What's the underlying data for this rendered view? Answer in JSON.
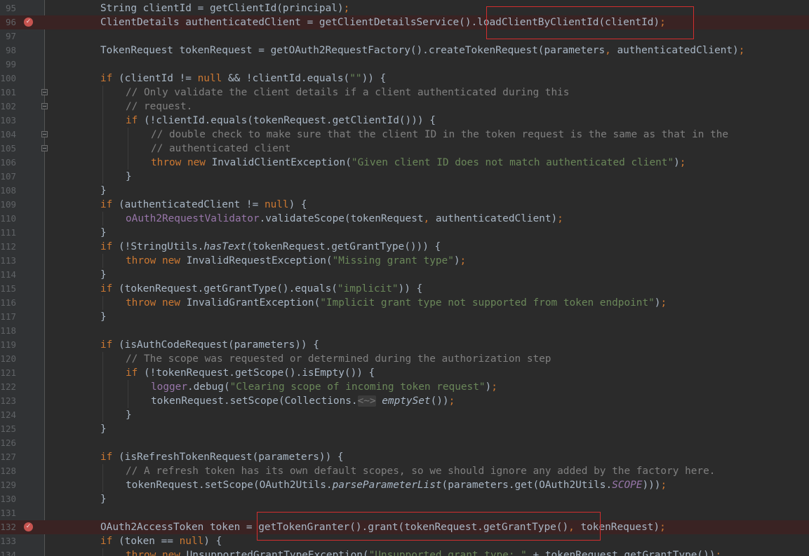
{
  "editor": {
    "lines": [
      {
        "n": "95",
        "indent": 0,
        "tokens": [
          [
            "",
            "String clientId = getClientId(principal)"
          ],
          [
            "kw",
            ";"
          ]
        ]
      },
      {
        "n": "96",
        "indent": 0,
        "breakpoint": true,
        "tokens": [
          [
            "",
            "ClientDetails authenticatedClient = getClientDetailsService().loadClientByClientId(clientId)"
          ],
          [
            "kw",
            ";"
          ]
        ]
      },
      {
        "n": "97",
        "indent": 0,
        "tokens": []
      },
      {
        "n": "98",
        "indent": 0,
        "tokens": [
          [
            "",
            "TokenRequest tokenRequest = getOAuth2RequestFactory().createTokenRequest(parameters"
          ],
          [
            "kw",
            ","
          ],
          [
            "",
            " authenticatedClient)"
          ],
          [
            "kw",
            ";"
          ]
        ]
      },
      {
        "n": "99",
        "indent": 0,
        "tokens": []
      },
      {
        "n": "100",
        "indent": 0,
        "tokens": [
          [
            "kw",
            "if"
          ],
          [
            "",
            " (clientId != "
          ],
          [
            "kw",
            "null"
          ],
          [
            "",
            " && !clientId.equals("
          ],
          [
            "str",
            "\"\""
          ],
          [
            "",
            ")) {"
          ]
        ]
      },
      {
        "n": "101",
        "indent": 1,
        "fold": true,
        "tokens": [
          [
            "cmt",
            "// Only validate the client details if a client authenticated during this"
          ]
        ]
      },
      {
        "n": "102",
        "indent": 1,
        "fold": true,
        "tokens": [
          [
            "cmt",
            "// request."
          ]
        ]
      },
      {
        "n": "103",
        "indent": 1,
        "tokens": [
          [
            "kw",
            "if"
          ],
          [
            "",
            " (!clientId.equals(tokenRequest.getClientId())) {"
          ]
        ]
      },
      {
        "n": "104",
        "indent": 2,
        "fold": true,
        "tokens": [
          [
            "cmt",
            "// double check to make sure that the client ID in the token request is the same as that in the"
          ]
        ]
      },
      {
        "n": "105",
        "indent": 2,
        "fold": true,
        "tokens": [
          [
            "cmt",
            "// authenticated client"
          ]
        ]
      },
      {
        "n": "106",
        "indent": 2,
        "tokens": [
          [
            "kw",
            "throw new"
          ],
          [
            "",
            " InvalidClientException("
          ],
          [
            "str",
            "\"Given client ID does not match authenticated client\""
          ],
          [
            "",
            ")"
          ],
          [
            "kw",
            ";"
          ]
        ]
      },
      {
        "n": "107",
        "indent": 1,
        "tokens": [
          [
            "",
            "}"
          ]
        ]
      },
      {
        "n": "108",
        "indent": 0,
        "tokens": [
          [
            "",
            "}"
          ]
        ]
      },
      {
        "n": "109",
        "indent": 0,
        "tokens": [
          [
            "kw",
            "if"
          ],
          [
            "",
            " (authenticatedClient != "
          ],
          [
            "kw",
            "null"
          ],
          [
            "",
            ") {"
          ]
        ]
      },
      {
        "n": "110",
        "indent": 1,
        "tokens": [
          [
            "fld",
            "oAuth2RequestValidator"
          ],
          [
            "",
            ".validateScope(tokenRequest"
          ],
          [
            "kw",
            ","
          ],
          [
            "",
            " authenticatedClient)"
          ],
          [
            "kw",
            ";"
          ]
        ]
      },
      {
        "n": "111",
        "indent": 0,
        "tokens": [
          [
            "",
            "}"
          ]
        ]
      },
      {
        "n": "112",
        "indent": 0,
        "tokens": [
          [
            "kw",
            "if"
          ],
          [
            "",
            " (!StringUtils."
          ],
          [
            "sm",
            "hasText"
          ],
          [
            "",
            "(tokenRequest.getGrantType())) {"
          ]
        ]
      },
      {
        "n": "113",
        "indent": 1,
        "tokens": [
          [
            "kw",
            "throw new"
          ],
          [
            "",
            " InvalidRequestException("
          ],
          [
            "str",
            "\"Missing grant type\""
          ],
          [
            "",
            ")"
          ],
          [
            "kw",
            ";"
          ]
        ]
      },
      {
        "n": "114",
        "indent": 0,
        "tokens": [
          [
            "",
            "}"
          ]
        ]
      },
      {
        "n": "115",
        "indent": 0,
        "tokens": [
          [
            "kw",
            "if"
          ],
          [
            "",
            " (tokenRequest.getGrantType().equals("
          ],
          [
            "str",
            "\"implicit\""
          ],
          [
            "",
            ")) {"
          ]
        ]
      },
      {
        "n": "116",
        "indent": 1,
        "tokens": [
          [
            "kw",
            "throw new"
          ],
          [
            "",
            " InvalidGrantException("
          ],
          [
            "str",
            "\"Implicit grant type not supported from token endpoint\""
          ],
          [
            "",
            ")"
          ],
          [
            "kw",
            ";"
          ]
        ]
      },
      {
        "n": "117",
        "indent": 0,
        "tokens": [
          [
            "",
            "}"
          ]
        ]
      },
      {
        "n": "118",
        "indent": 0,
        "tokens": []
      },
      {
        "n": "119",
        "indent": 0,
        "tokens": [
          [
            "kw",
            "if"
          ],
          [
            "",
            " (isAuthCodeRequest(parameters)) {"
          ]
        ]
      },
      {
        "n": "120",
        "indent": 1,
        "tokens": [
          [
            "cmt",
            "// The scope was requested or determined during the authorization step"
          ]
        ]
      },
      {
        "n": "121",
        "indent": 1,
        "tokens": [
          [
            "kw",
            "if"
          ],
          [
            "",
            " (!tokenRequest.getScope().isEmpty()) {"
          ]
        ]
      },
      {
        "n": "122",
        "indent": 2,
        "tokens": [
          [
            "fld",
            "logger"
          ],
          [
            "",
            ".debug("
          ],
          [
            "str",
            "\"Clearing scope of incoming token request\""
          ],
          [
            "",
            ")"
          ],
          [
            "kw",
            ";"
          ]
        ]
      },
      {
        "n": "123",
        "indent": 2,
        "tokens": [
          [
            "",
            "tokenRequest.setScope(Collections."
          ],
          [
            "hint",
            "<~>"
          ],
          [
            "",
            " "
          ],
          [
            "sm",
            "emptySet"
          ],
          [
            "",
            "())"
          ],
          [
            "kw",
            ";"
          ]
        ]
      },
      {
        "n": "124",
        "indent": 1,
        "tokens": [
          [
            "",
            "}"
          ]
        ]
      },
      {
        "n": "125",
        "indent": 0,
        "tokens": [
          [
            "",
            "}"
          ]
        ]
      },
      {
        "n": "126",
        "indent": 0,
        "tokens": []
      },
      {
        "n": "127",
        "indent": 0,
        "tokens": [
          [
            "kw",
            "if"
          ],
          [
            "",
            " (isRefreshTokenRequest(parameters)) {"
          ]
        ]
      },
      {
        "n": "128",
        "indent": 1,
        "tokens": [
          [
            "cmt",
            "// A refresh token has its own default scopes, so we should ignore any added by the factory here."
          ]
        ]
      },
      {
        "n": "129",
        "indent": 1,
        "tokens": [
          [
            "",
            "tokenRequest.setScope(OAuth2Utils."
          ],
          [
            "sm",
            "parseParameterList"
          ],
          [
            "",
            "(parameters.get(OAuth2Utils."
          ],
          [
            "cst",
            "SCOPE"
          ],
          [
            "",
            ")))"
          ],
          [
            "kw",
            ";"
          ]
        ]
      },
      {
        "n": "130",
        "indent": 0,
        "tokens": [
          [
            "",
            "}"
          ]
        ]
      },
      {
        "n": "131",
        "indent": 0,
        "tokens": []
      },
      {
        "n": "132",
        "indent": 0,
        "breakpoint": true,
        "tokens": [
          [
            "",
            "OAuth2AccessToken token = getTokenGranter().grant(tokenRequest.getGrantType()"
          ],
          [
            "kw",
            ","
          ],
          [
            "",
            " tokenRequest)"
          ],
          [
            "kw",
            ";"
          ]
        ]
      },
      {
        "n": "133",
        "indent": 0,
        "tokens": [
          [
            "kw",
            "if"
          ],
          [
            "",
            " (token == "
          ],
          [
            "kw",
            "null"
          ],
          [
            "",
            ") {"
          ]
        ]
      },
      {
        "n": "134",
        "indent": 1,
        "tokens": [
          [
            "kw",
            "throw new"
          ],
          [
            "",
            " UnsupportedGrantTypeException("
          ],
          [
            "str",
            "\"Unsupported grant type: \""
          ],
          [
            "",
            " + tokenRequest.getGrantType())"
          ],
          [
            "kw",
            ";"
          ]
        ]
      }
    ],
    "breakpoint_icon": "breakpoint-check-icon",
    "fold_icon": "fold-marker-icon",
    "colors": {
      "background": "#2b2b2b",
      "gutter": "#313335",
      "keyword": "#cc7832",
      "string": "#6a8759",
      "comment": "#808080",
      "field": "#9876aa",
      "text": "#a9b7c6",
      "highlight_box": "#d22e2e",
      "breakpoint": "#c75450"
    }
  }
}
